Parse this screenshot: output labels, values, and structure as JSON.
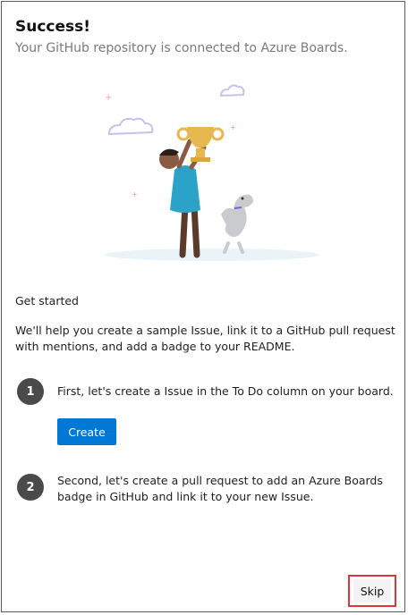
{
  "header": {
    "title": "Success!",
    "subtitle": "Your GitHub repository is connected to Azure Boards."
  },
  "illustration": {
    "icon": "person-holding-trophy-with-dog-illustration",
    "colors": {
      "shirt": "#2ba3c9",
      "trophy": "#e6b84f",
      "cloud": "#c9c0f0"
    }
  },
  "get_started": {
    "title": "Get started",
    "intro": "We'll help you create a sample Issue, link it to a GitHub pull request with mentions, and add a badge to your README."
  },
  "steps": [
    {
      "number": "1",
      "text": "First, let's create a Issue in the To Do column on your board."
    },
    {
      "number": "2",
      "text": "Second, let's create a pull request to add an Azure Boards badge in GitHub and link it to your new Issue."
    }
  ],
  "actions": {
    "create_label": "Create",
    "skip_label": "Skip"
  },
  "colors": {
    "primary": "#0078d4",
    "step_badge": "#4a4a4a",
    "highlight": "#e0343b"
  }
}
